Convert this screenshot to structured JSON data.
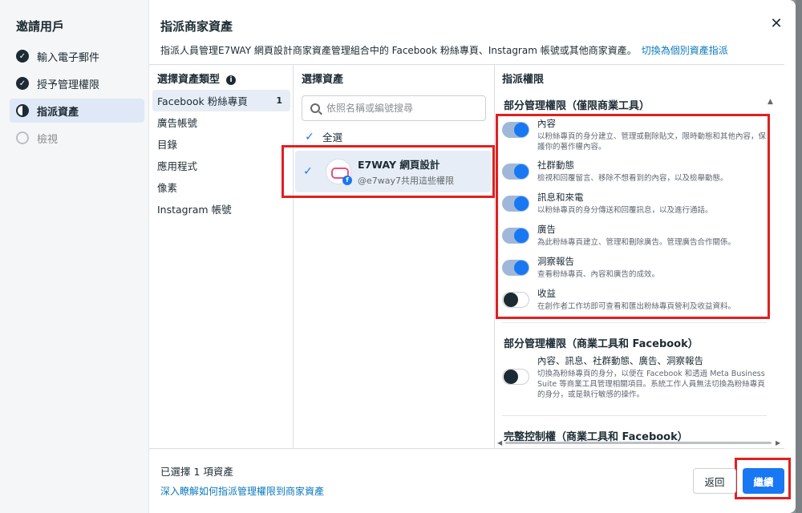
{
  "steps": {
    "title": "邀請用戶",
    "items": [
      {
        "label": "輸入電子郵件",
        "state": "done"
      },
      {
        "label": "授予管理權限",
        "state": "done"
      },
      {
        "label": "指派資產",
        "state": "current"
      },
      {
        "label": "檢視",
        "state": "future"
      }
    ]
  },
  "header": {
    "title": "指派商家資產",
    "description": "指派人員管理E7WAY 網頁設計商家資產管理組合中的 Facebook 粉絲專頁、Instagram 帳號或其他商家資產。",
    "switch_link": "切換為個別資產指派",
    "close_icon": "close-icon"
  },
  "columns": {
    "types_header": "選擇資產類型",
    "assets_header": "選擇資產",
    "permissions_header": "指派權限"
  },
  "asset_types": [
    {
      "label": "Facebook 粉絲專頁",
      "count": "1",
      "selected": true
    },
    {
      "label": "廣告帳號",
      "count": "",
      "selected": false
    },
    {
      "label": "目錄",
      "count": "",
      "selected": false
    },
    {
      "label": "應用程式",
      "count": "",
      "selected": false
    },
    {
      "label": "像素",
      "count": "",
      "selected": false
    },
    {
      "label": "Instagram 帳號",
      "count": "",
      "selected": false
    }
  ],
  "assets": {
    "search_placeholder": "依照名稱或編號搜尋",
    "select_all": "全選",
    "item": {
      "name": "E7WAY 網頁設計",
      "sub": "@e7way7共用這些權限",
      "checked": true
    }
  },
  "permissions": {
    "partial_section": "部分管理權限（僅限商業工具）",
    "items": [
      {
        "name": "內容",
        "desc": "以粉絲專頁的身分建立、管理或刪除貼文，限時動態和其他內容，保護你的著作權內容。",
        "on": true
      },
      {
        "name": "社群動態",
        "desc": "檢視和回覆留言、移除不想看到的內容，以及檢舉動態。",
        "on": true
      },
      {
        "name": "訊息和來電",
        "desc": "以粉絲專頁的身分傳送和回覆訊息，以及進行通話。",
        "on": true
      },
      {
        "name": "廣告",
        "desc": "為此粉絲專頁建立、管理和刪除廣告。管理廣告合作關係。",
        "on": true
      },
      {
        "name": "洞察報告",
        "desc": "查看粉絲專頁、內容和廣告的成效。",
        "on": true
      },
      {
        "name": "收益",
        "desc": "在創作者工作坊即可查看和匯出粉絲專頁營利及收益資料。",
        "on": false
      }
    ],
    "partial_fb_section": "部分管理權限（商業工具和 Facebook）",
    "partial_fb_item": {
      "name": "內容、訊息、社群動態、廣告、洞察報告",
      "desc": "切換為粉絲專頁的身分，以便在 Facebook 和透過 Meta Business Suite 等商業工具管理相關項目。系統工作人員無法切換為粉絲專頁的身分，或是執行敏感的操作。",
      "on": false
    },
    "full_section": "完整控制權（商業工具和 Facebook）"
  },
  "footer": {
    "selected_count": "已選擇 1 項資產",
    "learn_link": "深入瞭解如何指派管理權限到商家資產",
    "back_button": "返回",
    "next_button": "繼續"
  },
  "colors": {
    "accent": "#1877f2",
    "highlight": "#e0201f"
  }
}
